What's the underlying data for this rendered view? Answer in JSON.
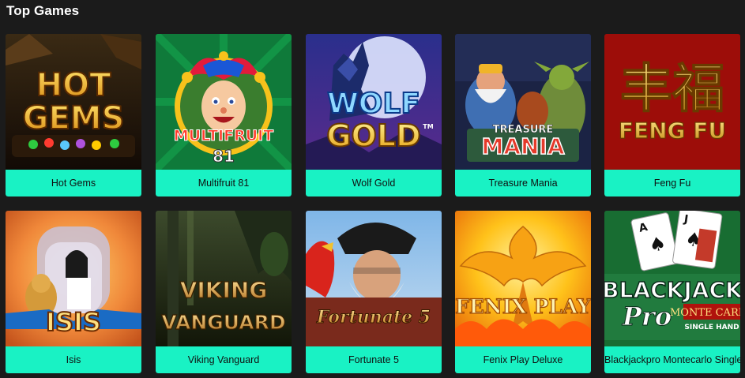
{
  "section": {
    "title": "Top Games"
  },
  "games": [
    {
      "title": "Hot Gems",
      "logo": [
        "HOT",
        "GEMS"
      ]
    },
    {
      "title": "Multifruit 81",
      "logo": [
        "MULTIFRUIT",
        "81"
      ]
    },
    {
      "title": "Wolf Gold",
      "logo": [
        "WOLF",
        "GOLD",
        "TM"
      ]
    },
    {
      "title": "Treasure Mania",
      "logo": [
        "TREASURE",
        "MANIA"
      ]
    },
    {
      "title": "Feng Fu",
      "logo": [
        "丰福",
        "FENG FU"
      ]
    },
    {
      "title": "Isis",
      "logo": [
        "ISIS"
      ]
    },
    {
      "title": "Viking Vanguard",
      "logo": [
        "VIKING",
        "VANGUARD"
      ]
    },
    {
      "title": "Fortunate 5",
      "logo": [
        "Fortunate 5"
      ]
    },
    {
      "title": "Fenix Play Deluxe",
      "logo": [
        "FENIX PLAY"
      ]
    },
    {
      "title": "Blackjackpro Montecarlo Singlehand",
      "logo": [
        "BLACKJACK",
        "Pro",
        "MONTE CARLO",
        "SINGLE HAND"
      ]
    }
  ]
}
